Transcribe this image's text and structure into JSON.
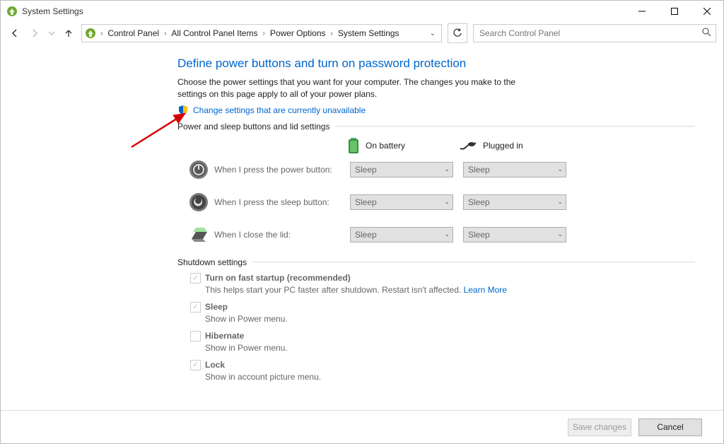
{
  "titlebar": {
    "title": "System Settings"
  },
  "breadcrumb": {
    "items": [
      "Control Panel",
      "All Control Panel Items",
      "Power Options",
      "System Settings"
    ]
  },
  "search": {
    "placeholder": "Search Control Panel"
  },
  "page": {
    "title": "Define power buttons and turn on password protection",
    "description": "Choose the power settings that you want for your computer. The changes you make to the settings on this page apply to all of your power plans.",
    "change_link": "Change settings that are currently unavailable"
  },
  "power_group": {
    "label": "Power and sleep buttons and lid settings",
    "col_battery": "On battery",
    "col_plugged": "Plugged in",
    "rows": [
      {
        "label": "When I press the power button:",
        "battery": "Sleep",
        "plugged": "Sleep"
      },
      {
        "label": "When I press the sleep button:",
        "battery": "Sleep",
        "plugged": "Sleep"
      },
      {
        "label": "When I close the lid:",
        "battery": "Sleep",
        "plugged": "Sleep"
      }
    ]
  },
  "shutdown": {
    "label": "Shutdown settings",
    "items": [
      {
        "title": "Turn on fast startup (recommended)",
        "desc_pre": "This helps start your PC faster after shutdown. Restart isn't affected. ",
        "link": "Learn More",
        "checked": true
      },
      {
        "title": "Sleep",
        "desc": "Show in Power menu.",
        "checked": true
      },
      {
        "title": "Hibernate",
        "desc": "Show in Power menu.",
        "checked": false
      },
      {
        "title": "Lock",
        "desc": "Show in account picture menu.",
        "checked": true
      }
    ]
  },
  "footer": {
    "save": "Save changes",
    "cancel": "Cancel"
  }
}
